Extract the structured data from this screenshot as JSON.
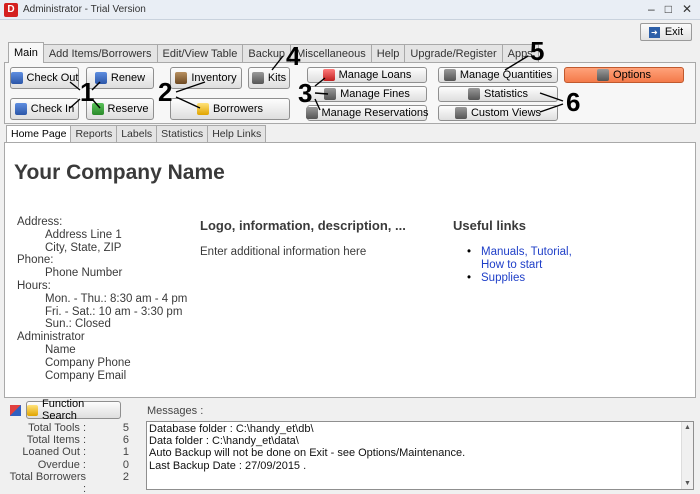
{
  "window": {
    "title": "Administrator - Trial Version",
    "app_icon_letter": "D",
    "minimize_glyph": "–",
    "maximize_glyph": "□",
    "close_glyph": "✕"
  },
  "exit_button": {
    "label": "Exit",
    "icon_glyph": "➜"
  },
  "main_tabs": [
    "Main",
    "Add Items/Borrowers",
    "Edit/View Table",
    "Backup",
    "Miscellaneous",
    "Help",
    "Upgrade/Register",
    "Apps"
  ],
  "ribbon": {
    "check_out": "Check Out",
    "renew": "Renew",
    "check_in": "Check In",
    "reserve": "Reserve",
    "inventory": "Inventory",
    "kits": "Kits",
    "borrowers": "Borrowers",
    "manage_loans": "Manage Loans",
    "manage_fines": "Manage Fines",
    "manage_reservations": "Manage Reservations",
    "manage_quantities": "Manage Quantities",
    "statistics": "Statistics",
    "custom_views": "Custom Views",
    "options": "Options"
  },
  "annotations": [
    "1",
    "2",
    "3",
    "4",
    "5",
    "6"
  ],
  "sub_tabs": [
    "Home Page",
    "Reports",
    "Labels",
    "Statistics",
    "Help Links"
  ],
  "home": {
    "company_name": "Your Company Name",
    "address_lines": [
      {
        "text": "Address:",
        "indent": false
      },
      {
        "text": "Address Line 1",
        "indent": true
      },
      {
        "text": "City, State, ZIP",
        "indent": true
      },
      {
        "text": "Phone:",
        "indent": false
      },
      {
        "text": "Phone Number",
        "indent": true
      },
      {
        "text": "Hours:",
        "indent": false
      },
      {
        "text": "Mon. - Thu.: 8:30 am - 4 pm",
        "indent": true
      },
      {
        "text": "Fri. - Sat.: 10 am - 3:30 pm",
        "indent": true
      },
      {
        "text": "Sun.: Closed",
        "indent": true
      },
      {
        "text": "Administrator",
        "indent": false
      },
      {
        "text": "Name",
        "indent": true
      },
      {
        "text": "Company Phone",
        "indent": true
      },
      {
        "text": "Company Email",
        "indent": true
      }
    ],
    "logo_heading": "Logo, information, description, ...",
    "logo_text": "Enter additional information here",
    "links_heading": "Useful links",
    "links": [
      "Manuals, Tutorial,\nHow to start",
      "Supplies"
    ]
  },
  "function_search": {
    "label": "Function Search"
  },
  "messages_label": "Messages :",
  "stats": [
    {
      "label": "Total Tools :",
      "value": "5"
    },
    {
      "label": "Total Items :",
      "value": "6"
    },
    {
      "label": "Loaned Out :",
      "value": "1"
    },
    {
      "label": "Overdue :",
      "value": "0"
    },
    {
      "label": "Total Borrowers :",
      "value": "2"
    }
  ],
  "messages": [
    "Database folder : C:\\handy_et\\db\\",
    "Data folder : C:\\handy_et\\data\\",
    "Auto Backup will not be done on Exit - see Options/Maintenance.",
    "Last Backup Date : 27/09/2015 ."
  ],
  "colors": {
    "options_bg": "#f47a4a",
    "link": "#1f3fc8"
  }
}
